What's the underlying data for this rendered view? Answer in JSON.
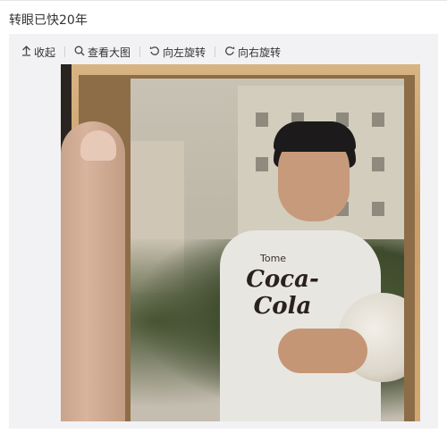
{
  "post": {
    "text": "转眼已快20年"
  },
  "toolbar": {
    "items": [
      {
        "label": "收起",
        "icon": "collapse-up-icon"
      },
      {
        "label": "查看大图",
        "icon": "magnifier-icon"
      },
      {
        "label": "向左旋转",
        "icon": "rotate-left-icon"
      },
      {
        "label": "向右旋转",
        "icon": "rotate-right-icon"
      }
    ]
  },
  "photo": {
    "shirt_logo_top": "Tome",
    "shirt_logo": "Coca-Cola"
  },
  "colors": {
    "text": "#333333",
    "media_bg": "#f2f2f5",
    "frame": "#d2a871"
  }
}
